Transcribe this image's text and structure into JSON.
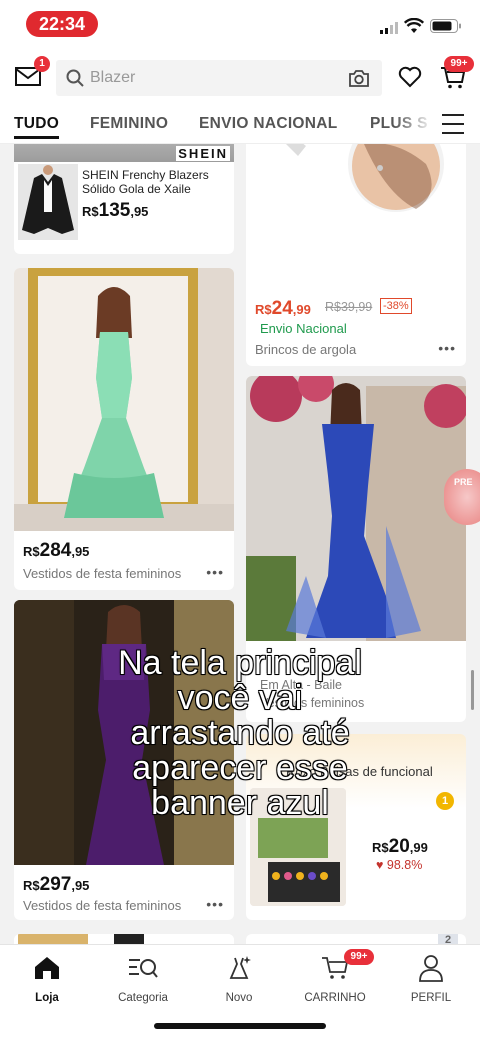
{
  "status_bar": {
    "time": "22:34"
  },
  "header": {
    "mail_badge": "1",
    "search_placeholder": "Blazer",
    "cart_badge": "99+"
  },
  "tabs": [
    {
      "label": "TUDO",
      "active": true
    },
    {
      "label": "FEMININO"
    },
    {
      "label": "ENVIO NACIONAL"
    },
    {
      "label": "PLUS S"
    }
  ],
  "feed": {
    "blazer": {
      "brand": "SHEIN",
      "title": "SHEIN Frenchy Blazers Sólido Gola de Xaile",
      "currency": "R$",
      "price_int": "135",
      "price_dec": ",95"
    },
    "earring": {
      "currency": "R$",
      "price_int": "24",
      "price_dec": ",99",
      "old_price": "R$39,99",
      "discount": "-38%",
      "shipping": "Envio Nacional",
      "category": "Brincos de argola"
    },
    "green_dress": {
      "currency": "R$",
      "price_int": "284",
      "price_dec": ",95",
      "category": "Vestidos de festa femininos"
    },
    "blue_dress": {
      "line1": "Em Alta - Baile",
      "line2": "Vestidos femininos"
    },
    "purple_dress": {
      "currency": "R$",
      "price_int": "297",
      "price_dec": ",95",
      "category": "Vestidos de festa femininos"
    },
    "rank_card": {
      "header": "Roxo Bolsas de funcional",
      "medal": "1",
      "currency": "R$",
      "price_int": "20",
      "price_dec": ",99",
      "rating": "98.8%"
    },
    "rank_card2": {
      "medal": "2"
    },
    "promo_float": "PRE"
  },
  "caption": {
    "lines": [
      "Na tela principal",
      "você vai",
      "arrastando até",
      "aparecer esse",
      "banner azul"
    ]
  },
  "bottom_nav": [
    {
      "label": "Loja",
      "icon": "home-icon",
      "active": true
    },
    {
      "label": "Categoria",
      "icon": "category-icon"
    },
    {
      "label": "Novo",
      "icon": "new-dress-icon"
    },
    {
      "label": "CARRINHO",
      "icon": "cart-icon",
      "badge": "99+"
    },
    {
      "label": "PERFIL",
      "icon": "profile-icon"
    }
  ],
  "colors": {
    "accent_red": "#e8303a",
    "price_red": "#e0492b",
    "shipping_green": "#1f9a4d"
  }
}
